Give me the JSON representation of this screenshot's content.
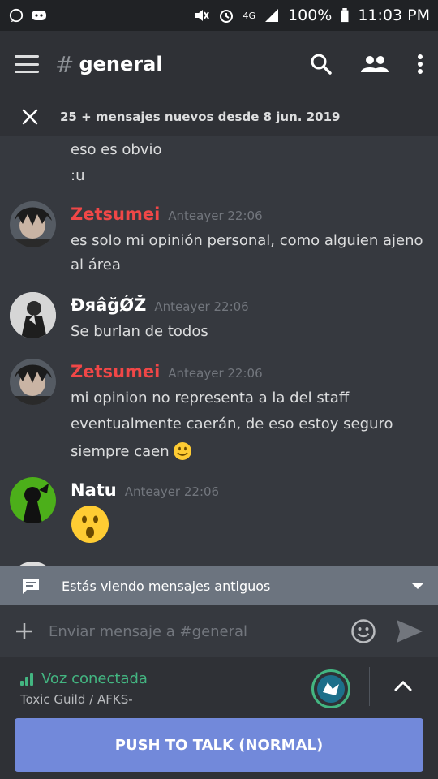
{
  "status_bar": {
    "battery": "100%",
    "time": "11:03 PM",
    "network": "4G"
  },
  "header": {
    "channel_hash": "#",
    "channel_name": "general"
  },
  "new_messages_banner": "25 + mensajes nuevos desde 8 jun. 2019",
  "continued_lines": [
    "eso es obvio",
    ":u"
  ],
  "messages": [
    {
      "user": "Zetsumei",
      "user_color": "#f04747",
      "timestamp": "Anteayer 22:06",
      "lines": [
        "es solo mi opinión personal, como alguien ajeno",
        "al área"
      ]
    },
    {
      "user": "ĐяâğǾŽ",
      "user_color": "#ffffff",
      "timestamp": "Anteayer 22:06",
      "lines": [
        "Se burlan de todos"
      ]
    },
    {
      "user": "Zetsumei",
      "user_color": "#f04747",
      "timestamp": "Anteayer 22:06",
      "lines": [
        "mi opinion no representa a la del staff",
        "eventualmente caerán, de eso estoy seguro",
        "siempre caen"
      ]
    },
    {
      "user": "Natu",
      "user_color": "#ffffff",
      "timestamp": "Anteayer 22:06",
      "lines": []
    }
  ],
  "old_messages_bar": "Estás viendo mensajes antiguos",
  "input": {
    "placeholder": "Enviar mensaje a #general"
  },
  "voice": {
    "status": "Voz conectada",
    "channel": "Toxic Guild / AFKS-",
    "push_to_talk": "PUSH TO TALK (NORMAL)"
  },
  "colors": {
    "accent": "#7289da",
    "voice_green": "#43b581",
    "background": "#36393f",
    "header_bg": "#2f3136"
  }
}
